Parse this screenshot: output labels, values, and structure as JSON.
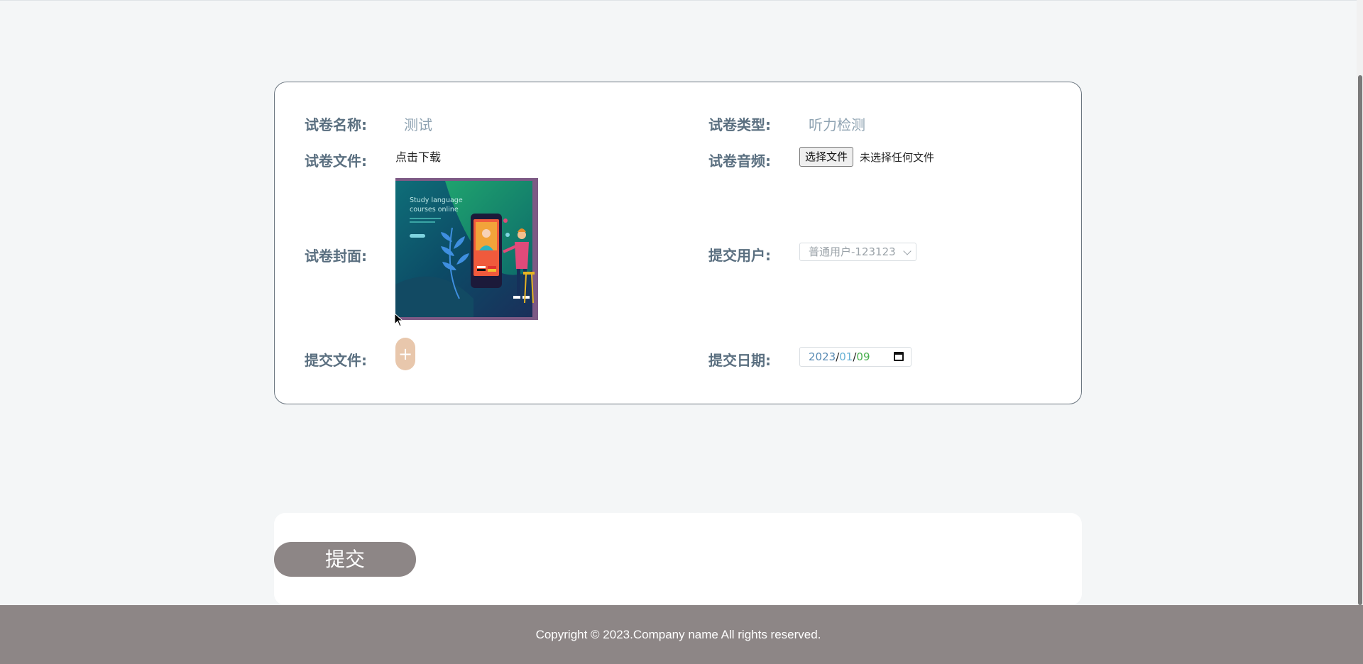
{
  "form": {
    "paper_name_label": "试卷名称:",
    "paper_name_value": "测试",
    "paper_type_label": "试卷类型:",
    "paper_type_value": "听力检测",
    "paper_file_label": "试卷文件:",
    "paper_file_link": "点击下载",
    "paper_audio_label": "试卷音频:",
    "choose_file_button": "选择文件",
    "no_file_chosen": "未选择任何文件",
    "paper_cover_label": "试卷封面:",
    "submit_user_label": "提交用户:",
    "submit_user_value": "普通用户-123123",
    "submit_file_label": "提交文件:",
    "add_file_symbol": "+",
    "submit_date_label": "提交日期:",
    "date": {
      "year": "2023",
      "month": "01",
      "day": "09",
      "separator": "/"
    }
  },
  "cover_image": {
    "title_line1": "Study language",
    "title_line2": "courses online"
  },
  "submit_button": "提交",
  "footer": {
    "copyright": "Copyright © 2023.Company name All rights reserved."
  },
  "colors": {
    "footer_bg": "#8d8686",
    "submit_bg": "#8d8686",
    "add_button_bg": "#e8c7ac",
    "label_color": "#5a6f80"
  }
}
